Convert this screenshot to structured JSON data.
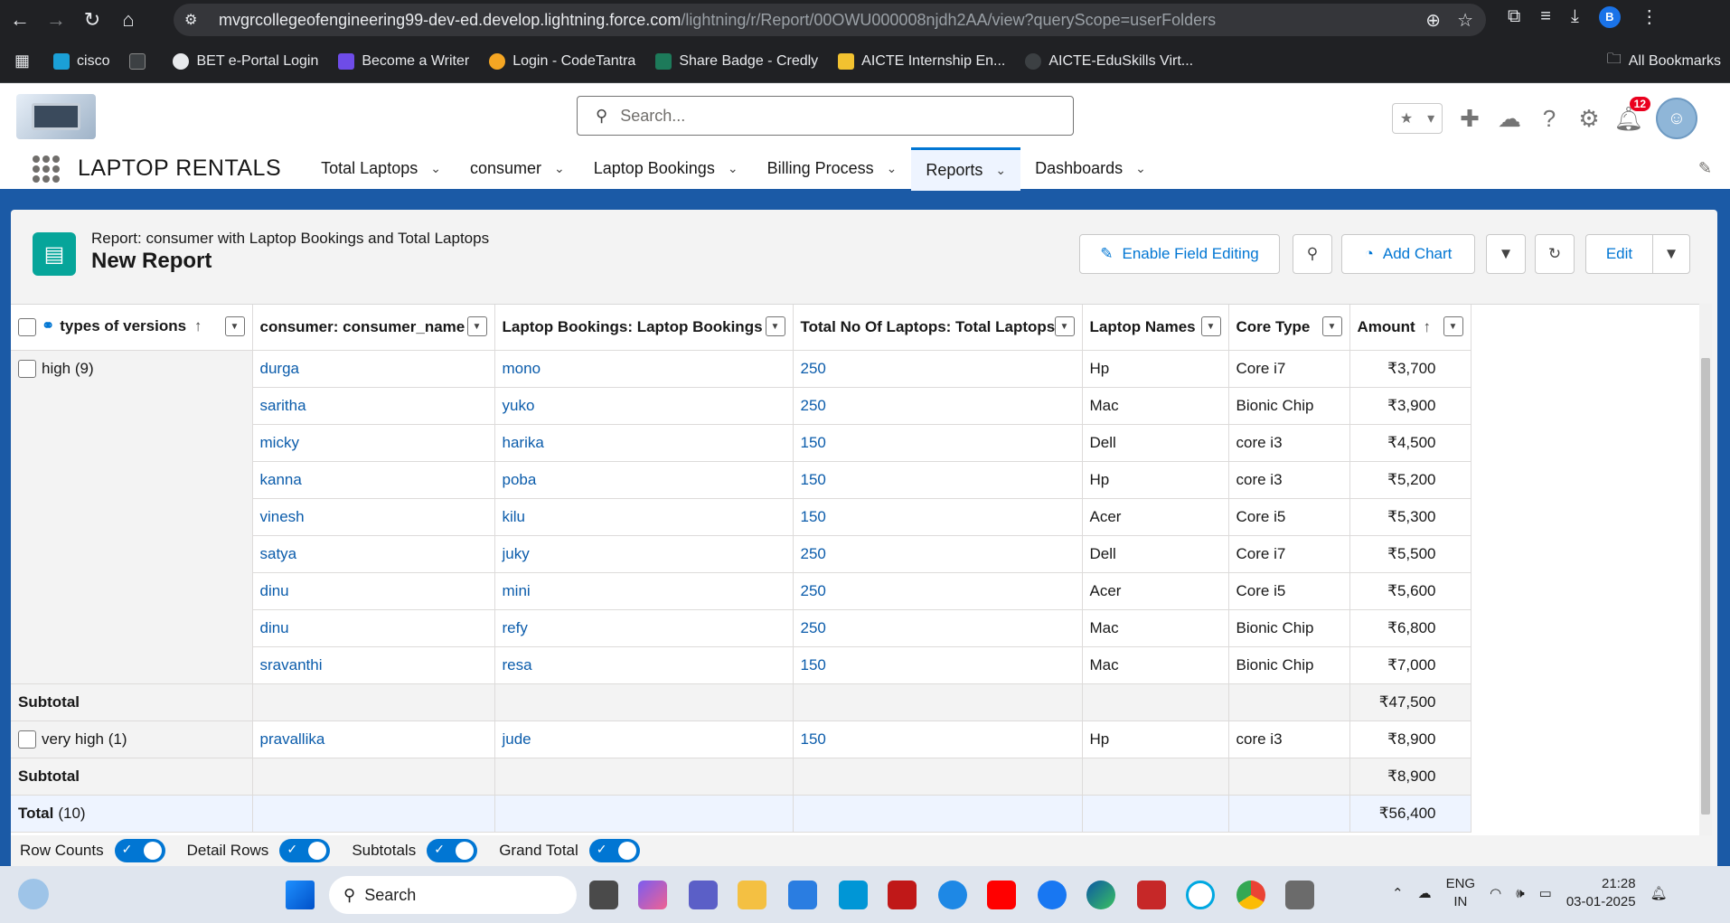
{
  "browser": {
    "url_host": "mvgrcollegeofengineering99-dev-ed.develop.lightning.force.com",
    "url_path": "/lightning/r/Report/00OWU000008njdh2AA/view?queryScope=userFolders",
    "profile_initial": "B",
    "bookmarks": [
      "cisco",
      "BET e-Portal Login",
      "Become a Writer",
      "Login - CodeTantra",
      "Share Badge - Credly",
      "AICTE Internship En...",
      "AICTE-EduSkills Virt..."
    ],
    "all_bookmarks": "All Bookmarks"
  },
  "header": {
    "search_placeholder": "Search...",
    "notification_count": "12"
  },
  "app": {
    "name": "LAPTOP RENTALS",
    "tabs": [
      "Total Laptops",
      "consumer",
      "Laptop Bookings",
      "Billing Process",
      "Reports",
      "Dashboards"
    ],
    "active_tab": "Reports"
  },
  "report": {
    "subtitle": "Report: consumer with Laptop Bookings and Total Laptops",
    "title": "New Report",
    "buttons": {
      "enable_field_editing": "Enable Field Editing",
      "add_chart": "Add Chart",
      "edit": "Edit"
    },
    "columns": [
      "types of versions",
      "consumer: consumer_name",
      "Laptop Bookings: Laptop Bookings",
      "Total No Of Laptops: Total Laptops",
      "Laptop Names",
      "Core Type",
      "Amount"
    ],
    "groups": [
      {
        "label": "high (9)",
        "rows": [
          [
            "durga",
            "mono",
            "250",
            "Hp",
            "Core i7",
            "₹3,700"
          ],
          [
            "saritha",
            "yuko",
            "250",
            "Mac",
            "Bionic Chip",
            "₹3,900"
          ],
          [
            "micky",
            "harika",
            "150",
            "Dell",
            "core i3",
            "₹4,500"
          ],
          [
            "kanna",
            "poba",
            "150",
            "Hp",
            "core i3",
            "₹5,200"
          ],
          [
            "vinesh",
            "kilu",
            "150",
            "Acer",
            "Core i5",
            "₹5,300"
          ],
          [
            "satya",
            "juky",
            "250",
            "Dell",
            "Core i7",
            "₹5,500"
          ],
          [
            "dinu",
            "mini",
            "250",
            "Acer",
            "Core i5",
            "₹5,600"
          ],
          [
            "dinu",
            "refy",
            "250",
            "Mac",
            "Bionic Chip",
            "₹6,800"
          ],
          [
            "sravanthi",
            "resa",
            "150",
            "Mac",
            "Bionic Chip",
            "₹7,000"
          ]
        ],
        "subtotal_label": "Subtotal",
        "subtotal": "₹47,500"
      },
      {
        "label": "very high (1)",
        "rows": [
          [
            "pravallika",
            "jude",
            "150",
            "Hp",
            "core i3",
            "₹8,900"
          ]
        ],
        "subtotal_label": "Subtotal",
        "subtotal": "₹8,900"
      }
    ],
    "total_label": "Total",
    "total_count": "(10)",
    "total": "₹56,400",
    "toggles": [
      "Row Counts",
      "Detail Rows",
      "Subtotals",
      "Grand Total"
    ]
  },
  "taskbar": {
    "search": "Search",
    "lang_1": "ENG",
    "lang_2": "IN",
    "time": "21:28",
    "date": "03-01-2025"
  }
}
